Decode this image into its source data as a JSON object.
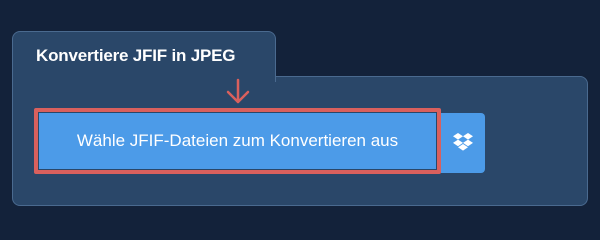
{
  "section": {
    "title": "Konvertiere JFIF in JPEG"
  },
  "upload": {
    "button_label": "Wähle JFIF-Dateien zum Konvertieren aus",
    "dropbox_icon": "dropbox-icon"
  },
  "annotation": {
    "arrow_icon": "arrow-down-icon",
    "highlight_color": "#d9605d"
  },
  "colors": {
    "page_background": "#13223a",
    "panel_background": "#2a4769",
    "button_background": "#4c9be8"
  }
}
